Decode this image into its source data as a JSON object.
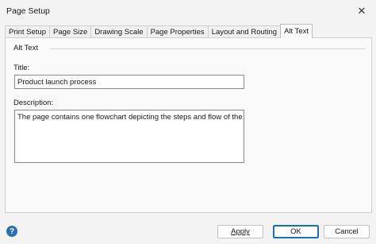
{
  "window": {
    "title": "Page Setup",
    "close_glyph": "✕"
  },
  "tabs": [
    {
      "label": "Print Setup",
      "active": false
    },
    {
      "label": "Page Size",
      "active": false
    },
    {
      "label": "Drawing Scale",
      "active": false
    },
    {
      "label": "Page Properties",
      "active": false
    },
    {
      "label": "Layout and Routing",
      "active": false
    },
    {
      "label": "Alt Text",
      "active": true
    }
  ],
  "alt_text": {
    "group_label": "Alt Text",
    "title_label": "Title:",
    "title_value": "Product launch process",
    "description_label": "Description:",
    "description_value": "The page contains one flowchart depicting the steps and flow of the"
  },
  "buttons": {
    "help_glyph": "?",
    "apply": "Apply",
    "ok": "OK",
    "cancel": "Cancel"
  },
  "colors": {
    "accent": "#1a6fc4",
    "help": "#2b6fb7"
  }
}
